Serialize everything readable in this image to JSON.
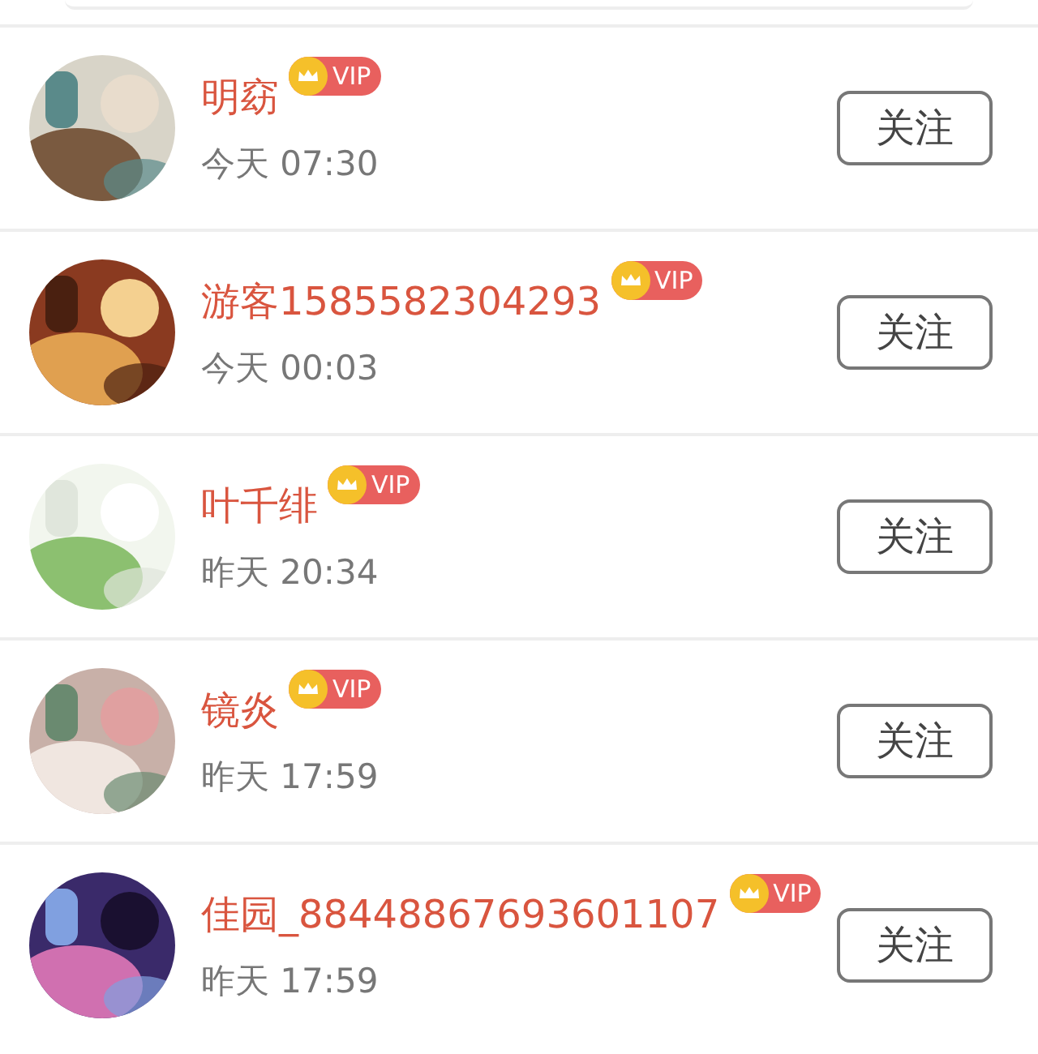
{
  "users": [
    {
      "name": "明窈",
      "badge": "VIP",
      "time": "今天 07:30",
      "button": "关注"
    },
    {
      "name": "游客1585582304293",
      "badge": "VIP",
      "time": "今天 00:03",
      "button": "关注"
    },
    {
      "name": "叶千绯",
      "badge": "VIP",
      "time": "昨天 20:34",
      "button": "关注"
    },
    {
      "name": "镜炎",
      "badge": "VIP",
      "time": "昨天 17:59",
      "button": "关注"
    },
    {
      "name": "佳园_88448867693601107",
      "badge": "VIP",
      "time": "昨天 17:59",
      "button": "关注"
    }
  ]
}
